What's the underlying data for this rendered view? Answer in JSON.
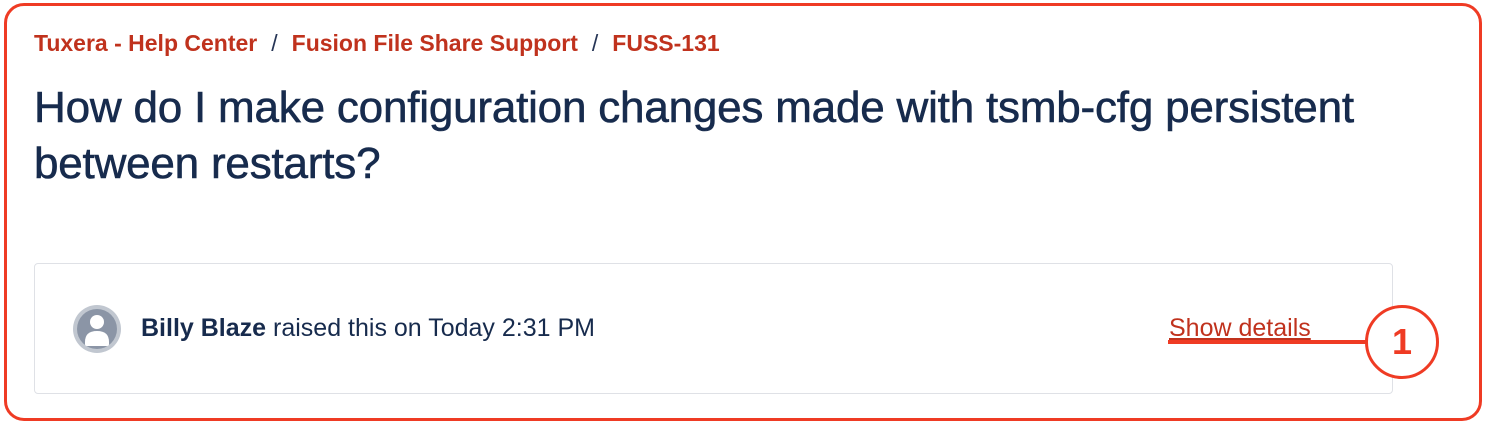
{
  "breadcrumb": {
    "items": [
      "Tuxera - Help Center",
      "Fusion File Share Support",
      "FUSS-131"
    ],
    "separator": "/"
  },
  "request": {
    "title": "How do I make configuration changes made with tsmb-cfg persistent between restarts?",
    "reporter": "Billy Blaze",
    "raised_text": "raised this on Today 2:31 PM",
    "avatar_icon": "user-avatar-icon",
    "show_details_label": "Show details"
  },
  "annotation": {
    "marker": "1",
    "color": "#ef3b24"
  },
  "colors": {
    "link": "#c0321d",
    "text": "#172b4d",
    "border": "#dfe1e6"
  }
}
